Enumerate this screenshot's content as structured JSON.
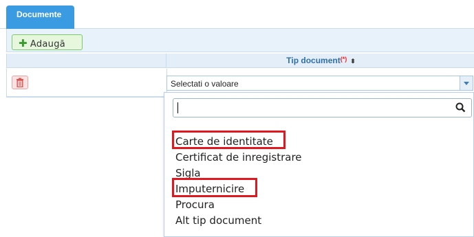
{
  "tab": {
    "label": "Documente"
  },
  "toolbar": {
    "add_label": "Adaugă"
  },
  "table": {
    "column_header": "Tip document",
    "required_marker": "(*)",
    "sort_symbol": "⬍"
  },
  "select": {
    "value": "Selectati o valoare"
  },
  "dropdown": {
    "search_value": "",
    "options": [
      "Carte de identitate",
      "Certificat de inregistrare",
      "Sigla",
      "Imputernicire",
      "Procura",
      "Alt tip document"
    ]
  },
  "colors": {
    "accent": "#3b9be2",
    "highlight": "#e0171f",
    "add_green": "#3a9b2e",
    "delete_red": "#d9534f"
  }
}
